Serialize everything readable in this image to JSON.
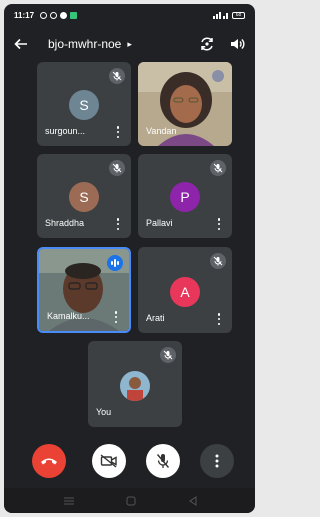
{
  "status": {
    "time": "11:17",
    "battery": "68"
  },
  "header": {
    "title": "bjo-mwhr-noe"
  },
  "participants": [
    {
      "name": "surgoun...",
      "initial": "S",
      "avatar_color": "#6e8593",
      "muted": true
    },
    {
      "name": "Vandan",
      "muted": false
    },
    {
      "name": "Shraddha",
      "initial": "S",
      "avatar_color": "#9c6b55",
      "muted": true
    },
    {
      "name": "Pallavi",
      "initial": "P",
      "avatar_color": "#8e24aa",
      "muted": true
    },
    {
      "name": "Kamalku...",
      "muted": false,
      "speaking": true
    },
    {
      "name": "Arati",
      "initial": "A",
      "avatar_color": "#e8375a",
      "muted": true
    }
  ],
  "self": {
    "name": "You",
    "muted": true
  },
  "colors": {
    "end_call": "#ea4335",
    "tile": "#3c4043",
    "background": "#202124",
    "active_border": "#4a8cf7"
  },
  "icons": [
    "back-arrow-icon",
    "switch-camera-icon",
    "speaker-icon",
    "mic-off-icon",
    "more-vert-icon",
    "end-call-icon",
    "camera-off-icon"
  ]
}
